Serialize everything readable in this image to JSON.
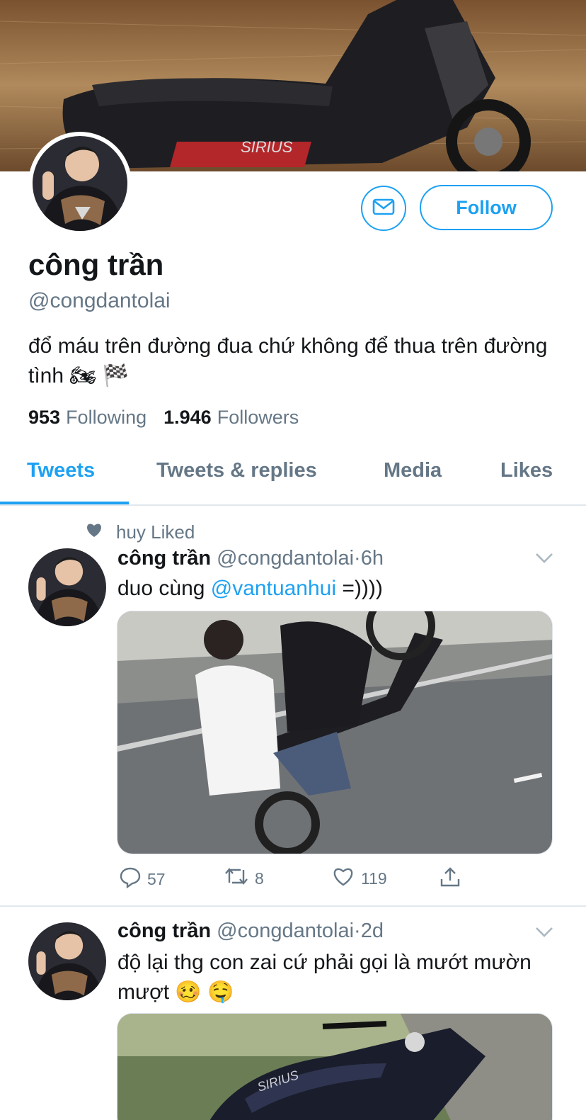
{
  "profile": {
    "display_name": "công trần",
    "handle": "@congdantolai",
    "bio": "đổ máu trên đường đua chứ không để thua trên đường tình 🏍 🏁",
    "following_count": "953",
    "following_label": "Following",
    "followers_count": "1.946",
    "followers_label": "Followers",
    "follow_label": "Follow"
  },
  "tabs": [
    {
      "label": "Tweets",
      "active": true
    },
    {
      "label": "Tweets & replies",
      "active": false
    },
    {
      "label": "Media",
      "active": false
    },
    {
      "label": "Likes",
      "active": false
    }
  ],
  "tweets": [
    {
      "social_context": "huy Liked",
      "name": "công trần",
      "handle": "@congdantolai",
      "separator": "·",
      "time": "6h",
      "text_before": "duo cùng ",
      "mention": "@vantuanhui",
      "text_after": " =))))",
      "replies": "57",
      "retweets": "8",
      "likes": "119"
    },
    {
      "name": "công trần",
      "handle": "@congdantolai",
      "separator": "·",
      "time": "2d",
      "text": "độ lại thg con zai cứ phải gọi là mướt mườn mượt 🥴 🤤"
    }
  ],
  "colors": {
    "accent": "#1da1f2",
    "text_primary": "#14171a",
    "text_secondary": "#657786",
    "border": "#e1e8ed"
  },
  "icons": {
    "message": "mail-icon",
    "dropdown": "chevron-down-icon",
    "liked": "heart-filled-icon",
    "reply": "comment-icon",
    "retweet": "retweet-icon",
    "like": "heart-icon",
    "share": "share-icon"
  }
}
